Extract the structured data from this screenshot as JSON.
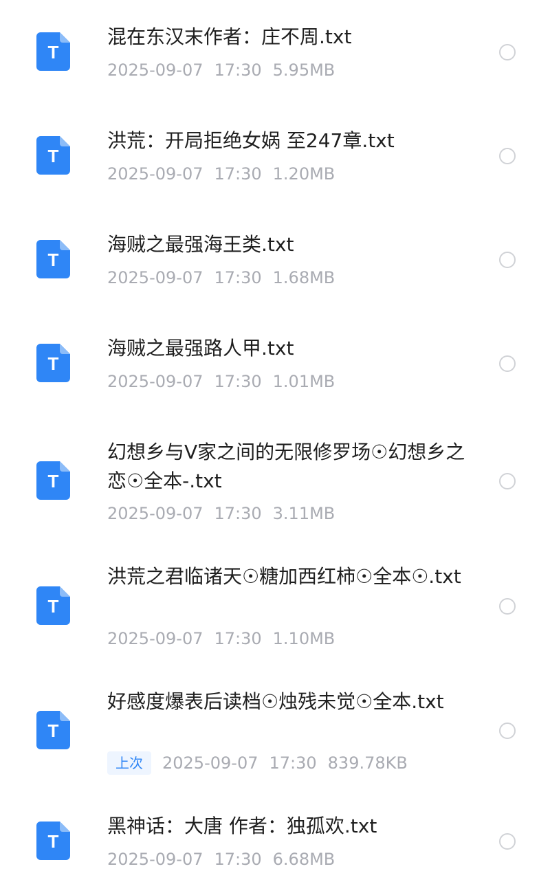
{
  "colors": {
    "icon_blue": "#2f86f6",
    "icon_fold": "#8cbcf8",
    "name_text": "#1f1f1f",
    "meta_text": "#a9abb2",
    "badge_bg": "#eef5ff",
    "radio_border": "#d0d2d6"
  },
  "files": [
    {
      "icon": "txt-file-icon",
      "icon_letter": "T",
      "name": "混在东汉末作者：庄不周.txt",
      "date": "2025-09-07",
      "time": "17:30",
      "size": "5.95MB",
      "badge": ""
    },
    {
      "icon": "txt-file-icon",
      "icon_letter": "T",
      "name": "洪荒：开局拒绝女娲 至247章.txt",
      "date": "2025-09-07",
      "time": "17:30",
      "size": "1.20MB",
      "badge": ""
    },
    {
      "icon": "txt-file-icon",
      "icon_letter": "T",
      "name": "海贼之最强海王类.txt",
      "date": "2025-09-07",
      "time": "17:30",
      "size": "1.68MB",
      "badge": ""
    },
    {
      "icon": "txt-file-icon",
      "icon_letter": "T",
      "name": "海贼之最强路人甲.txt",
      "date": "2025-09-07",
      "time": "17:30",
      "size": "1.01MB",
      "badge": ""
    },
    {
      "icon": "txt-file-icon",
      "icon_letter": "T",
      "name": "幻想乡与V家之间的无限修罗场☉幻想乡之恋☉全本-.txt",
      "date": "2025-09-07",
      "time": "17:30",
      "size": "3.11MB",
      "badge": ""
    },
    {
      "icon": "txt-file-icon",
      "icon_letter": "T",
      "name": "洪荒之君临诸天☉糖加西红柿☉全本☉.txt",
      "date": "2025-09-07",
      "time": "17:30",
      "size": "1.10MB",
      "badge": ""
    },
    {
      "icon": "txt-file-icon",
      "icon_letter": "T",
      "name": "好感度爆表后读档☉烛残未觉☉全本.txt",
      "date": "2025-09-07",
      "time": "17:30",
      "size": "839.78KB",
      "badge": "上次"
    },
    {
      "icon": "txt-file-icon",
      "icon_letter": "T",
      "name": "黑神话：大唐 作者：独孤欢.txt",
      "date": "2025-09-07",
      "time": "17:30",
      "size": "6.68MB",
      "badge": ""
    }
  ]
}
